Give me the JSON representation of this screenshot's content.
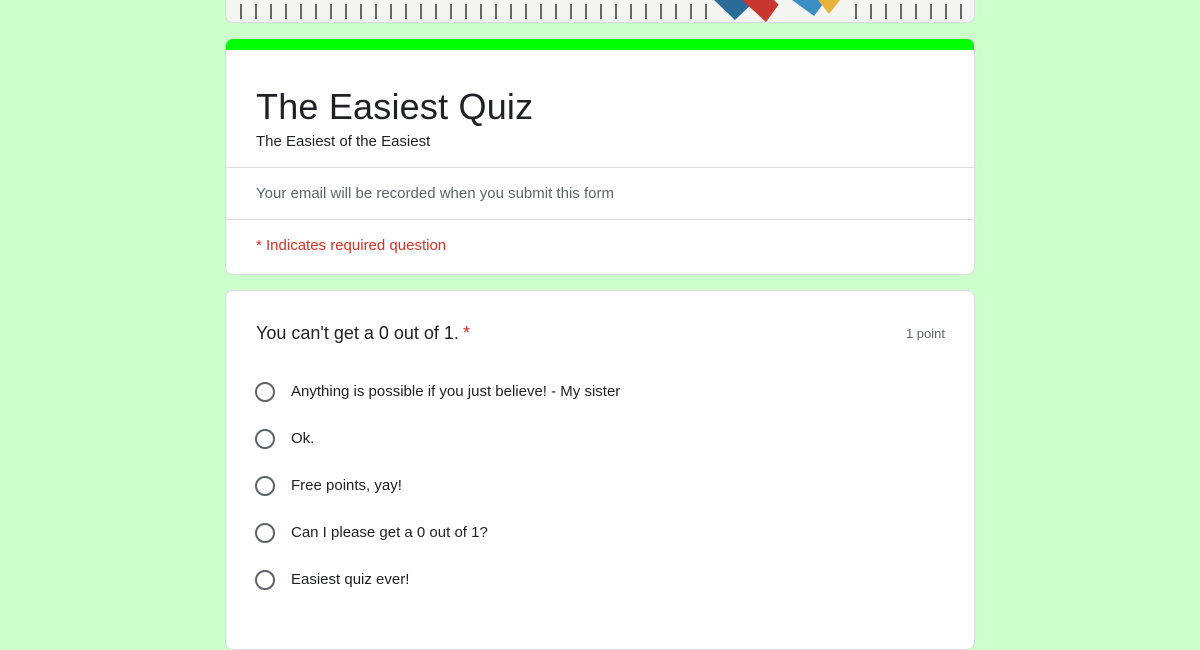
{
  "colors": {
    "page_background": "#ccffcc",
    "accent": "#00ff00",
    "required": "#d93025"
  },
  "form": {
    "title": "The Easiest Quiz",
    "description": "The Easiest of the Easiest",
    "email_note": "Your email will be recorded when you submit this form",
    "required_note": "* Indicates required question"
  },
  "question": {
    "title": "You can't get a 0 out of 1.",
    "required_marker": "*",
    "points": "1 point",
    "options": [
      {
        "label": "Anything is possible if you just believe! - My sister",
        "selected": false
      },
      {
        "label": "Ok.",
        "selected": false
      },
      {
        "label": "Free points, yay!",
        "selected": false
      },
      {
        "label": "Can I please get a 0 out of 1?",
        "selected": false
      },
      {
        "label": "Easiest quiz ever!",
        "selected": false
      }
    ]
  }
}
